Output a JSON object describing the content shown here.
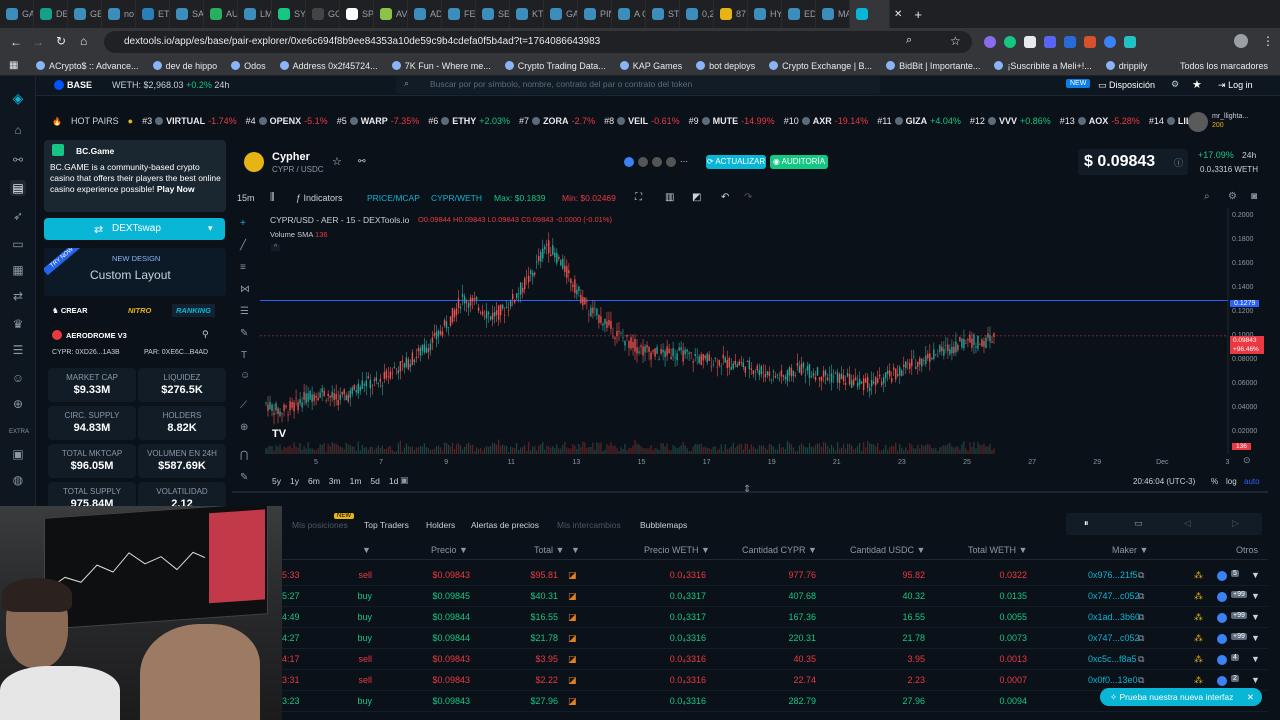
{
  "browser": {
    "tabs": [
      "GA",
      "DE",
      "GE",
      "no",
      "ETI",
      "SA",
      "AU",
      "LM",
      "SY",
      "GO",
      "SP",
      "AV",
      "AD",
      "FE",
      "SE",
      "KT",
      "GA",
      "PIN",
      "A C",
      "ST",
      "0,2",
      "87",
      "HY",
      "ED",
      "MA",
      ""
    ],
    "url": "dextools.io/app/es/base/pair-explorer/0xe6c694f8b9ee84353a10de59c9b4cdefa0f5b4ad?t=1764086643983",
    "bookmarks": [
      "ACrypto$ :: Advance...",
      "dev de hippo",
      "Odos",
      "Address 0x2f45724...",
      "7K Fun - Where me...",
      "Crypto Trading Data...",
      "KAP Games",
      "bot deploys",
      "Crypto Exchange | B...",
      "BidBit | Importante...",
      "¡Suscribite a Meli+!...",
      "drippily"
    ],
    "all_bookmarks": "Todos los marcadores"
  },
  "topstrip": {
    "chain": "BASE",
    "weth": "WETH: $2,968.03",
    "weth_change": "+0.2%",
    "weth_period": "24h",
    "search_placeholder": "Buscar por por símbolo, nombre, contrato del par o contrato del token",
    "new_badge": "NEW",
    "layout": "Disposición",
    "login": "Log in"
  },
  "hotpairs": {
    "label": "HOT PAIRS",
    "items": [
      {
        "rank": "#3",
        "name": "VIRTUAL",
        "chg": "-1.74%",
        "up": false
      },
      {
        "rank": "#4",
        "name": "OPENX",
        "chg": "-5.1%",
        "up": false
      },
      {
        "rank": "#5",
        "name": "WARP",
        "chg": "-7.35%",
        "up": false
      },
      {
        "rank": "#6",
        "name": "ETHY",
        "chg": "+2.03%",
        "up": true
      },
      {
        "rank": "#7",
        "name": "ZORA",
        "chg": "-2.7%",
        "up": false
      },
      {
        "rank": "#8",
        "name": "VEIL",
        "chg": "-0.61%",
        "up": false
      },
      {
        "rank": "#9",
        "name": "MUTE",
        "chg": "-14.99%",
        "up": false
      },
      {
        "rank": "#10",
        "name": "AXR",
        "chg": "-19.14%",
        "up": false
      },
      {
        "rank": "#11",
        "name": "GIZA",
        "chg": "+4.04%",
        "up": true
      },
      {
        "rank": "#12",
        "name": "VVV",
        "chg": "+0.86%",
        "up": true
      },
      {
        "rank": "#13",
        "name": "AOX",
        "chg": "-5.28%",
        "up": false
      },
      {
        "rank": "#14",
        "name": "LILB",
        "chg": "",
        "up": true
      }
    ]
  },
  "profile": {
    "name": "mr_llighta...",
    "sub": "200"
  },
  "ad": {
    "brand": "BC.Game",
    "text": "BC.GAME is a community-based crypto casino that offers their players the best online casino experience possible!",
    "cta": "Play Now"
  },
  "dextswap": "DEXTswap",
  "custom_layout": {
    "badge": "TRY NOW",
    "new_design": "NEW DESIGN",
    "title": "Custom Layout"
  },
  "tabs_left": {
    "create": "CREAR",
    "nitro": "NITRO",
    "ranking": "RANKING"
  },
  "dex": {
    "name": "AERODROME V3",
    "cypr": "CYPR: 0XD26...1A3B",
    "pair": "PAR: 0XE6C...B4AD"
  },
  "stats": [
    {
      "label": "MARKET CAP",
      "value": "$9.33M"
    },
    {
      "label": "LIQUIDEZ",
      "value": "$276.5K"
    },
    {
      "label": "CIRC. SUPPLY",
      "value": "94.83M"
    },
    {
      "label": "HOLDERS",
      "value": "8.82K"
    },
    {
      "label": "TOTAL MKTCAP",
      "value": "$96.05M"
    },
    {
      "label": "VOLUMEN EN 24H",
      "value": "$587.69K"
    },
    {
      "label": "TOTAL SUPPLY",
      "value": "975.84M"
    },
    {
      "label": "VOLATILIDAD",
      "value": "2.12"
    }
  ],
  "token": {
    "name": "Cypher",
    "pair": "CYPR / USDC",
    "update": "ACTUALIZAR",
    "audit": "AUDITORÍA",
    "price": "$ 0.09843",
    "change": "+17.09%",
    "period": "24h",
    "weth_price": "0.0₄3316",
    "weth_label": "WETH"
  },
  "toolbar": {
    "interval": "15m",
    "indicators": "Indicators",
    "price_mcap": "PRICE/MCAP",
    "cypr_weth": "CYPR/WETH",
    "max": "Max: $0.1839",
    "min": "Min: $0.02469"
  },
  "chart_data": {
    "type": "candlestick",
    "title": "CYPR/USD - AER - 15 - DEXTools.io",
    "ohlc_legend": {
      "o": "0.09844",
      "h": "0.09843",
      "l": "0.09843",
      "c": "0.09843",
      "chg": "-0.0000 (-0.01%)"
    },
    "volume_label": "Volume SMA",
    "volume_value": "136",
    "x_ticks": [
      "5",
      "7",
      "9",
      "11",
      "13",
      "15",
      "17",
      "19",
      "21",
      "23",
      "25",
      "27",
      "29",
      "Dec",
      "3"
    ],
    "y_ticks": [
      "0.2000",
      "0.1800",
      "0.1600",
      "0.1400",
      "0.1200",
      "0.1000",
      "0.08000",
      "0.06000",
      "0.04000",
      "0.02000"
    ],
    "ylim": [
      0.0,
      0.205
    ],
    "last_price": "0.09843",
    "last_change": "+96.46%",
    "hline_price": "0.1279",
    "vol_badge": "136",
    "series": [
      {
        "x": 0,
        "y": 0.042
      },
      {
        "x": 2,
        "y": 0.035
      },
      {
        "x": 4,
        "y": 0.04
      },
      {
        "x": 6,
        "y": 0.048
      },
      {
        "x": 8,
        "y": 0.052
      },
      {
        "x": 10,
        "y": 0.045
      },
      {
        "x": 12,
        "y": 0.05
      },
      {
        "x": 14,
        "y": 0.06
      },
      {
        "x": 16,
        "y": 0.058
      },
      {
        "x": 18,
        "y": 0.07
      },
      {
        "x": 20,
        "y": 0.075
      },
      {
        "x": 22,
        "y": 0.085
      },
      {
        "x": 24,
        "y": 0.095
      },
      {
        "x": 26,
        "y": 0.11
      },
      {
        "x": 28,
        "y": 0.13
      },
      {
        "x": 30,
        "y": 0.125
      },
      {
        "x": 32,
        "y": 0.115
      },
      {
        "x": 34,
        "y": 0.12
      },
      {
        "x": 36,
        "y": 0.135
      },
      {
        "x": 38,
        "y": 0.15
      },
      {
        "x": 40,
        "y": 0.175
      },
      {
        "x": 42,
        "y": 0.16
      },
      {
        "x": 44,
        "y": 0.14
      },
      {
        "x": 46,
        "y": 0.12
      },
      {
        "x": 48,
        "y": 0.112
      },
      {
        "x": 50,
        "y": 0.1
      },
      {
        "x": 52,
        "y": 0.092
      },
      {
        "x": 54,
        "y": 0.086
      },
      {
        "x": 56,
        "y": 0.083
      },
      {
        "x": 58,
        "y": 0.085
      },
      {
        "x": 60,
        "y": 0.082
      },
      {
        "x": 62,
        "y": 0.079
      },
      {
        "x": 64,
        "y": 0.078
      },
      {
        "x": 66,
        "y": 0.076
      },
      {
        "x": 68,
        "y": 0.074
      },
      {
        "x": 70,
        "y": 0.071
      },
      {
        "x": 72,
        "y": 0.066
      },
      {
        "x": 74,
        "y": 0.064
      },
      {
        "x": 76,
        "y": 0.072
      },
      {
        "x": 78,
        "y": 0.068
      },
      {
        "x": 80,
        "y": 0.065
      },
      {
        "x": 82,
        "y": 0.063
      },
      {
        "x": 84,
        "y": 0.06
      },
      {
        "x": 86,
        "y": 0.058
      },
      {
        "x": 88,
        "y": 0.062
      },
      {
        "x": 90,
        "y": 0.068
      },
      {
        "x": 92,
        "y": 0.075
      },
      {
        "x": 94,
        "y": 0.08
      },
      {
        "x": 96,
        "y": 0.085
      },
      {
        "x": 98,
        "y": 0.09
      },
      {
        "x": 100,
        "y": 0.095
      },
      {
        "x": 102,
        "y": 0.092
      },
      {
        "x": 104,
        "y": 0.098
      }
    ]
  },
  "chart_footer": {
    "ranges": [
      "5y",
      "1y",
      "6m",
      "3m",
      "1m",
      "5d",
      "1d"
    ],
    "time": "20:46:04 (UTC-3)",
    "pct": "%",
    "log": "log",
    "auto": "auto"
  },
  "trades_tabs": {
    "positions": "Mis posiciones",
    "new": "NEW",
    "top_traders": "Top Traders",
    "holders": "Holders",
    "alerts": "Alertas de precios",
    "exchanges": "Mis intercambios",
    "bubblemaps": "Bubblemaps"
  },
  "table": {
    "headers": [
      "Precio",
      "Total",
      "Precio WETH",
      "Cantidad CYPR",
      "Cantidad USDC",
      "Total WETH",
      "Maker",
      "Otros"
    ],
    "rows": [
      {
        "time": "5:33",
        "type": "sell",
        "price": "$0.09843",
        "total": "$95.81",
        "pw": "0.0₄3316",
        "cypr": "977.76",
        "usdc": "95.82",
        "tw": "0.0322",
        "maker": "0x976...21f5",
        "badge": "5"
      },
      {
        "time": "5:27",
        "type": "buy",
        "price": "$0.09845",
        "total": "$40.31",
        "pw": "0.0₄3317",
        "cypr": "407.68",
        "usdc": "40.32",
        "tw": "0.0135",
        "maker": "0x747...c052",
        "badge": "+99"
      },
      {
        "time": "4:49",
        "type": "buy",
        "price": "$0.09844",
        "total": "$16.55",
        "pw": "0.0₄3317",
        "cypr": "167.36",
        "usdc": "16.55",
        "tw": "0.0055",
        "maker": "0x1ad...3b60",
        "badge": "+99"
      },
      {
        "time": "4:27",
        "type": "buy",
        "price": "$0.09844",
        "total": "$21.78",
        "pw": "0.0₄3316",
        "cypr": "220.31",
        "usdc": "21.78",
        "tw": "0.0073",
        "maker": "0x747...c052",
        "badge": "+99"
      },
      {
        "time": "4:17",
        "type": "sell",
        "price": "$0.09843",
        "total": "$3.95",
        "pw": "0.0₄3316",
        "cypr": "40.35",
        "usdc": "3.95",
        "tw": "0.0013",
        "maker": "0xc5c...f8a5",
        "badge": "4"
      },
      {
        "time": "3:31",
        "type": "sell",
        "price": "$0.09843",
        "total": "$2.22",
        "pw": "0.0₄3316",
        "cypr": "22.74",
        "usdc": "2.23",
        "tw": "0.0007",
        "maker": "0x0f0...13e0",
        "badge": "2"
      },
      {
        "time": "3:23",
        "type": "buy",
        "price": "$0.09843",
        "total": "$27.96",
        "pw": "0.0₄3316",
        "cypr": "282.79",
        "usdc": "27.96",
        "tw": "0.0094",
        "maker": "",
        "badge": ""
      }
    ]
  },
  "try_new": "Prueba nuestra nueva interfaz"
}
